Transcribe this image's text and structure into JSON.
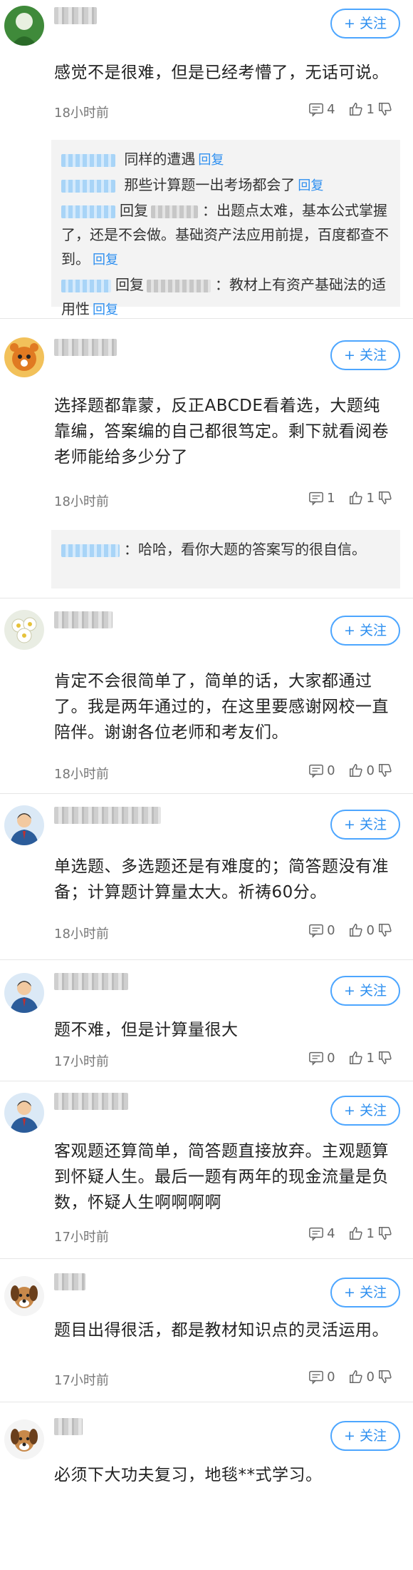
{
  "follow_label": "+ 关注",
  "comments": [
    {
      "text": "感觉不是很难，但是已经考懵了，无话可说。",
      "time": "18小时前",
      "comment_count": "4",
      "like_count": "1",
      "replies": [
        {
          "name": "",
          "text": "同样的遭遇",
          "link": "回复"
        },
        {
          "name": "",
          "text": "那些计算题一出考场都会了",
          "link": "回复"
        },
        {
          "name": "",
          "prefix": "回复",
          "text": "：出题点太难，基本公式掌握了，还是不会做。基础资产法应用前提，百度都查不到。",
          "link": "回复"
        },
        {
          "name": "",
          "prefix": "回复",
          "text": "：教材上有资产基础法的适用性",
          "link": "回复"
        }
      ]
    },
    {
      "text": "选择题都靠蒙，反正ABCDE看着选，大题纯靠编，答案编的自己都很笃定。剩下就看阅卷老师能给多少分了",
      "time": "18小时前",
      "comment_count": "1",
      "like_count": "1",
      "replies": [
        {
          "name": "",
          "text": "：哈哈，看你大题的答案写的很自信。"
        }
      ]
    },
    {
      "text": "肯定不会很简单了，简单的话，大家都通过了。我是两年通过的，在这里要感谢网校一直陪伴。谢谢各位老师和考友们。",
      "time": "18小时前",
      "comment_count": "0",
      "like_count": "0"
    },
    {
      "text": "单选题、多选题还是有难度的；简答题没有准备；计算题计算量太大。祈祷60分。",
      "time": "18小时前",
      "comment_count": "0",
      "like_count": "0"
    },
    {
      "text": "题不难，但是计算量很大",
      "time": "17小时前",
      "comment_count": "0",
      "like_count": "1"
    },
    {
      "text": "客观题还算简单，简答题直接放弃。主观题算到怀疑人生。最后一题有两年的现金流量是负数，怀疑人生啊啊啊啊",
      "time": "17小时前",
      "comment_count": "4",
      "like_count": "1"
    },
    {
      "text": "题目出得很活，都是教材知识点的灵活运用。",
      "time": "17小时前",
      "comment_count": "0",
      "like_count": "0"
    },
    {
      "text": "必须下大功夫复习，地毯**式学习。"
    }
  ]
}
